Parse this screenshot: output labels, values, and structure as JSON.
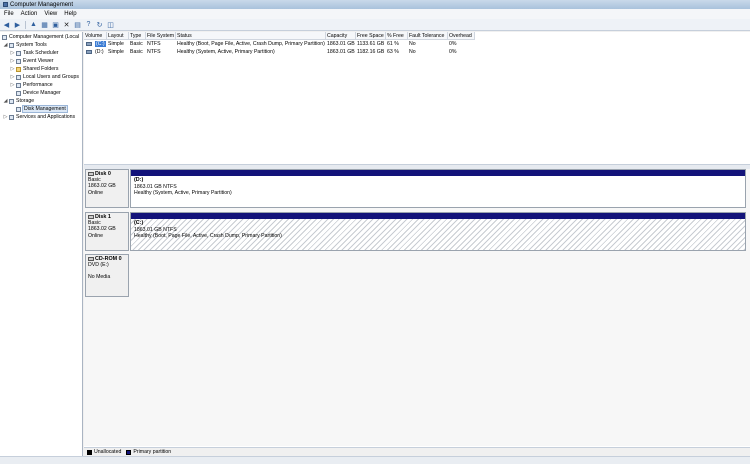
{
  "window": {
    "title": "Computer Management"
  },
  "menu": [
    "File",
    "Action",
    "View",
    "Help"
  ],
  "toolbar": {
    "icons": [
      "back-icon",
      "forward-icon",
      "up-icon",
      "properties-icon",
      "export-icon",
      "delete-icon",
      "help-icon",
      "refresh-icon",
      "disk-icon"
    ]
  },
  "tree": {
    "root": "Computer Management (Local",
    "system_tools": "System Tools",
    "task_scheduler": "Task Scheduler",
    "event_viewer": "Event Viewer",
    "shared_folders": "Shared Folders",
    "local_users": "Local Users and Groups",
    "performance": "Performance",
    "device_manager": "Device Manager",
    "storage": "Storage",
    "disk_management": "Disk Management",
    "services": "Services and Applications"
  },
  "volumes": {
    "headers": [
      "Volume",
      "Layout",
      "Type",
      "File System",
      "Status",
      "Capacity",
      "Free Space",
      "% Free",
      "Fault Tolerance",
      "Overhead"
    ],
    "rows": [
      [
        "(C:)",
        "Simple",
        "Basic",
        "NTFS",
        "Healthy (Boot, Page File, Active, Crash Dump, Primary Partition)",
        "1863.01 GB",
        "1133.61 GB",
        "61 %",
        "No",
        "0%"
      ],
      [
        "(D:)",
        "Simple",
        "Basic",
        "NTFS",
        "Healthy (System, Active, Primary Partition)",
        "1863.01 GB",
        "1182.16 GB",
        "63 %",
        "No",
        "0%"
      ]
    ]
  },
  "disks": [
    {
      "name": "Disk 0",
      "type": "Basic",
      "size": "1863.02 GB",
      "state": "Online",
      "part_name": "(D:)",
      "part_size": "1863.01 GB NTFS",
      "part_status": "Healthy (System, Active, Primary Partition)"
    },
    {
      "name": "Disk 1",
      "type": "Basic",
      "size": "1863.02 GB",
      "state": "Online",
      "part_name": "(C:)",
      "part_size": "1863.01 GB NTFS",
      "part_status": "Healthy (Boot, Page File, Active, Crash Dump, Primary Partition)"
    }
  ],
  "cdrom": {
    "name": "CD-ROM 0",
    "drive": "DVD (E:)",
    "media": "No Media"
  },
  "legend": [
    {
      "label": "Unallocated",
      "color": "#000000"
    },
    {
      "label": "Primary partition",
      "color": "#13137a"
    }
  ]
}
